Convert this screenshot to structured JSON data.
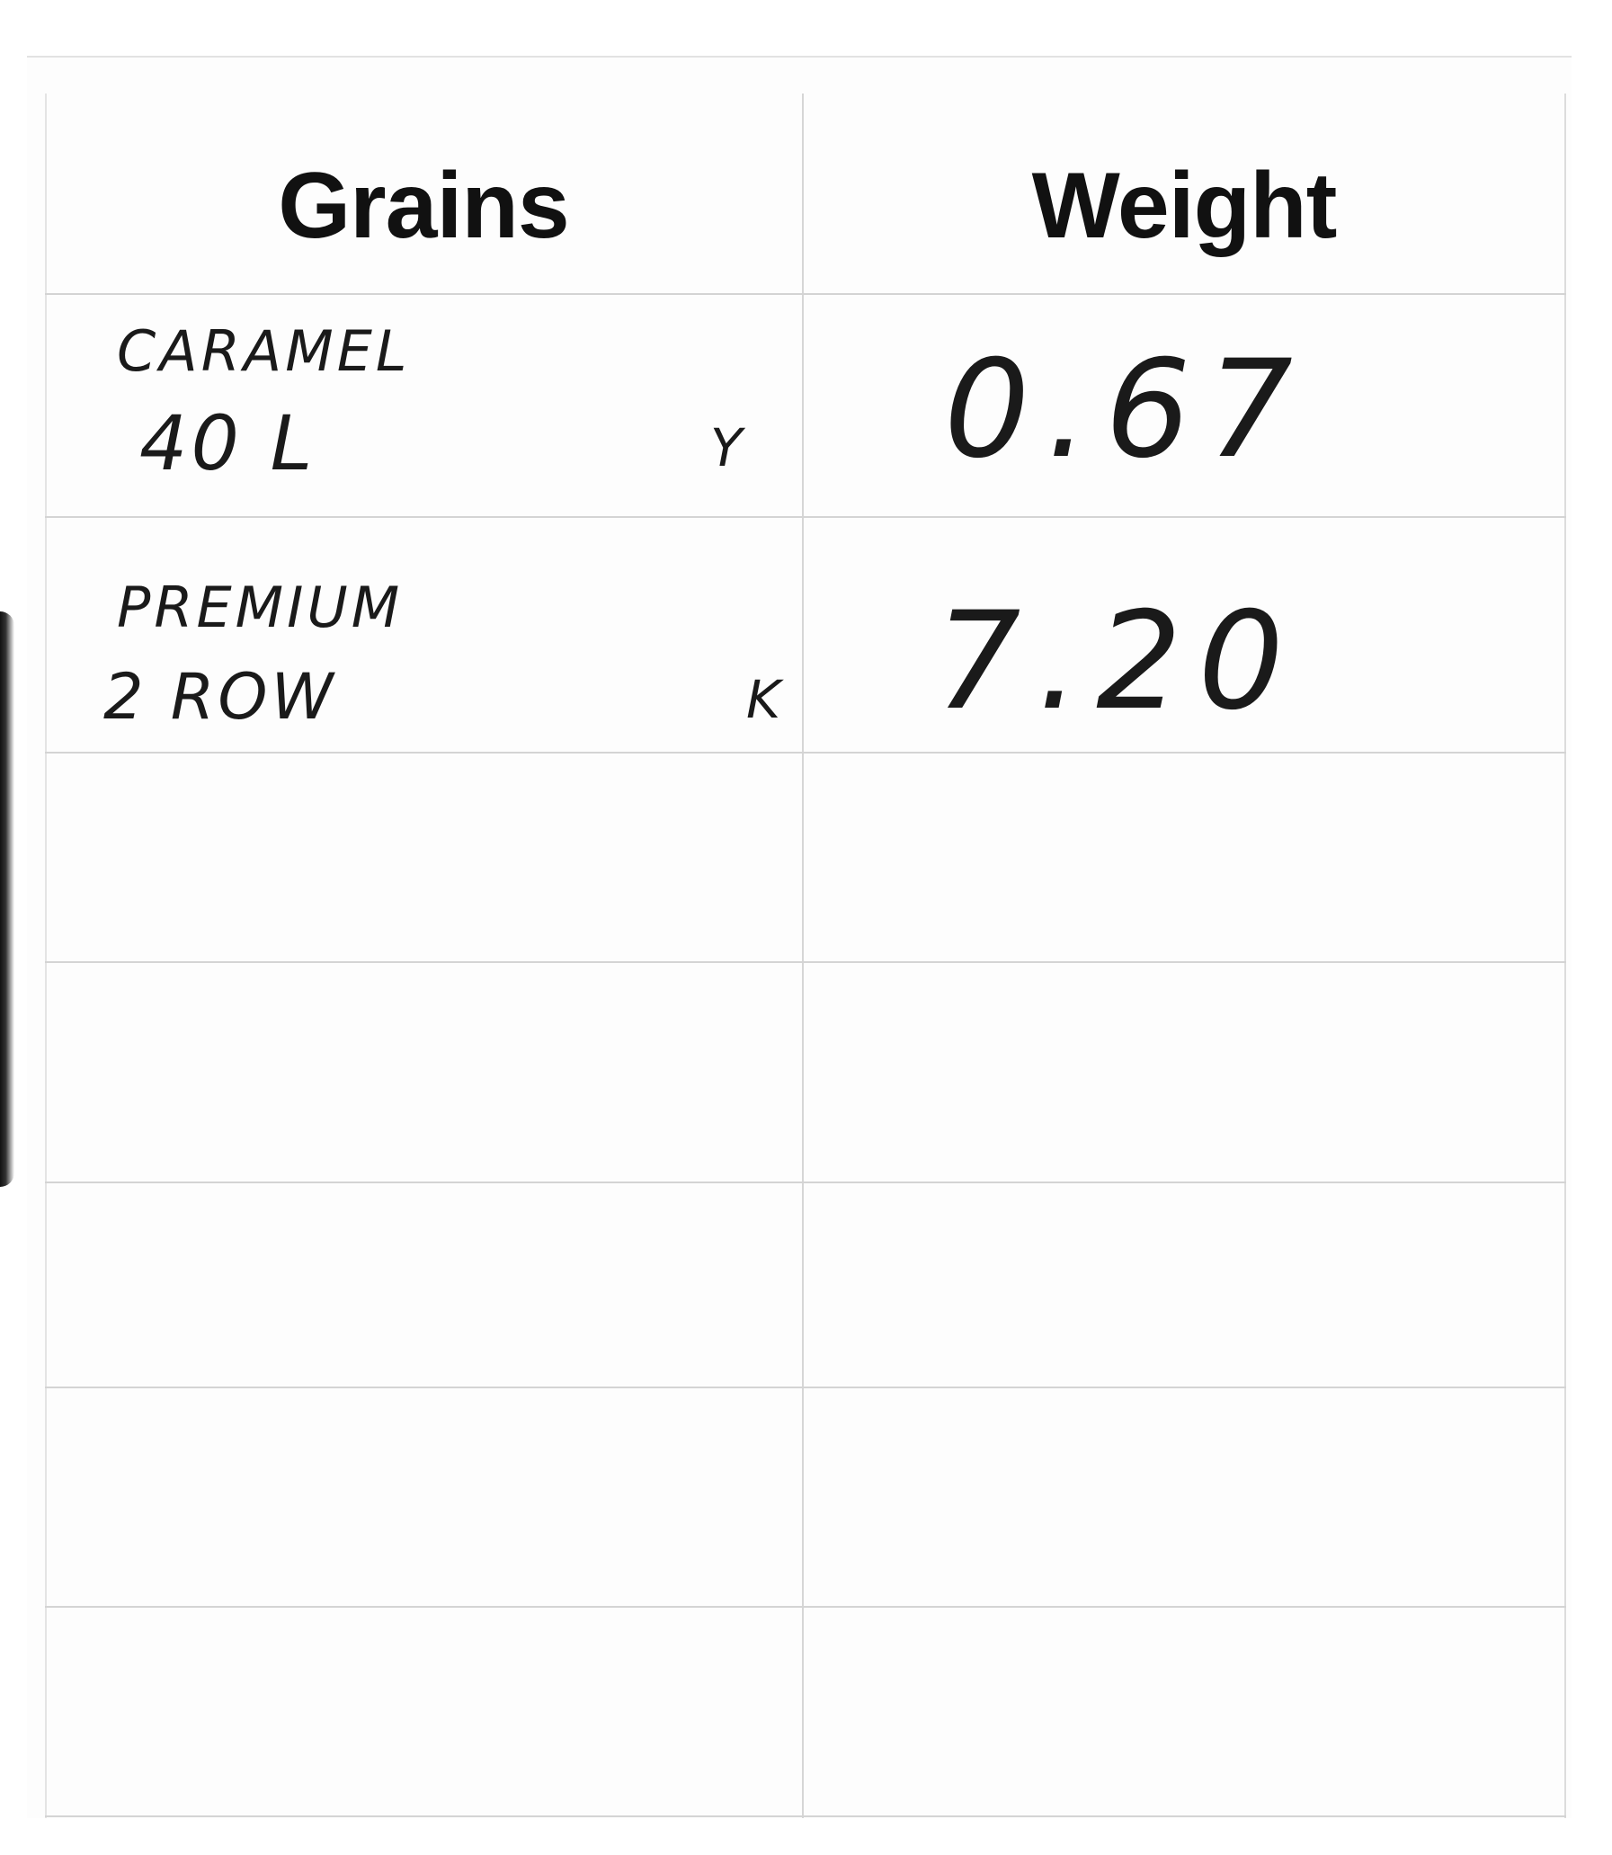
{
  "table": {
    "headers": {
      "grains": "Grains",
      "weight": "Weight"
    },
    "rows": [
      {
        "grain_line1": "CARAMEL",
        "grain_line2": "40 L",
        "mark": "Y",
        "weight": "0.67"
      },
      {
        "grain_line1": "PREMIUM",
        "grain_line2": "2 ROW",
        "mark": "K",
        "weight": "7.20"
      }
    ],
    "empty_rows": 5
  }
}
